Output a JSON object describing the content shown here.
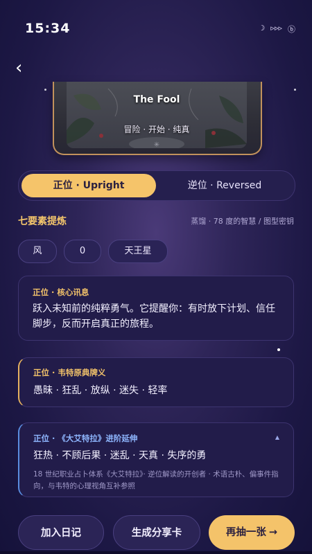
{
  "status": {
    "time": "15:34",
    "icons": [
      "moon-icon",
      "signal-icon",
      "battery-icon"
    ]
  },
  "card": {
    "name": "The Fool",
    "keywords": "冒险 · 开始 · 纯真"
  },
  "toggle": {
    "upright_label": "正位 · Upright",
    "reversed_label": "逆位 · Reversed",
    "selected": "upright"
  },
  "elements": {
    "heading": "七要素提炼",
    "note": "蒸馏 · 78 度的智慧 / 图型密钥",
    "chips": [
      "风",
      "0",
      "天王星"
    ]
  },
  "panels": {
    "core": {
      "label": "正位 · 核心讯息",
      "body": "跃入未知前的纯粹勇气。它提醒你：有时放下计划、信任脚步，反而开启真正的旅程。"
    },
    "waite": {
      "label": "正位 · 韦特原典牌义",
      "body": "愚昧 · 狂乱 · 放纵 · 迷失 · 轻率"
    },
    "etteilla": {
      "label": "正位 · 《大艾特拉》进阶延伸",
      "body": "狂热 · 不顾后果 · 迷乱 · 天真 · 失序的勇",
      "footnote": "18 世纪职业占卜体系《大艾特拉》· 逆位解读的开创者 · 术语古朴、偏事件指向，与韦特的心理视角互补参照"
    }
  },
  "actions": {
    "journal": "加入日记",
    "share": "生成分享卡",
    "redraw": "再抽一张",
    "redraw_arrow": "→"
  },
  "colors": {
    "accent": "#f4c36a",
    "background": "#1d1845",
    "link_blue": "#8fb7ff"
  }
}
